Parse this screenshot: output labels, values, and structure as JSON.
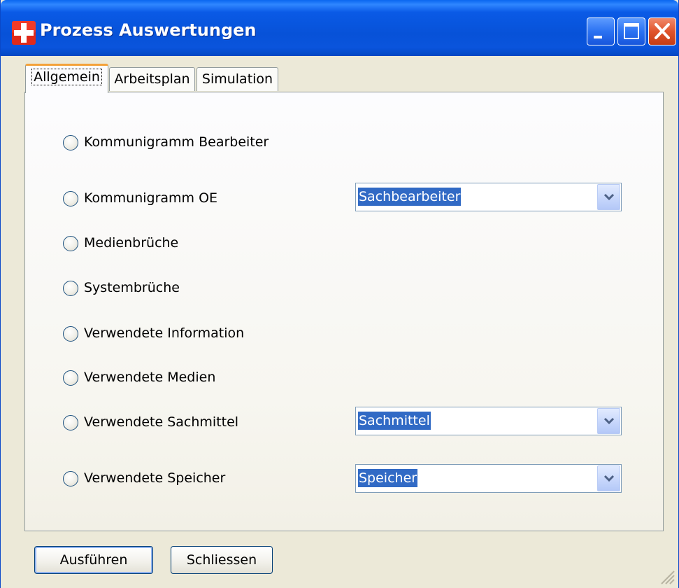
{
  "window": {
    "title": "Prozess Auswertungen",
    "titlebar_color": "#0a54dc"
  },
  "titlebar_buttons": {
    "minimize": "minimize-icon",
    "maximize": "maximize-icon",
    "close": "close-icon"
  },
  "tabs": [
    {
      "label": "Allgemein",
      "active": true
    },
    {
      "label": "Arbeitsplan",
      "active": false
    },
    {
      "label": "Simulation",
      "active": false
    }
  ],
  "options": [
    {
      "label": "Kommunigramm Bearbeiter"
    },
    {
      "label": "Kommunigramm OE"
    },
    {
      "label": "Medienbrüche"
    },
    {
      "label": "Systembrüche"
    },
    {
      "label": "Verwendete Information"
    },
    {
      "label": "Verwendete Medien"
    },
    {
      "label": "Verwendete Sachmittel"
    },
    {
      "label": "Verwendete Speicher"
    }
  ],
  "selects": {
    "oe": {
      "value": "Sachbearbeiter"
    },
    "sachmittel": {
      "value": "Sachmittel"
    },
    "speicher": {
      "value": "Speicher"
    }
  },
  "buttons": {
    "run": "Ausführen",
    "close": "Schliessen"
  },
  "colors": {
    "selection": "#316ac5",
    "tab_highlight": "#f4a23a",
    "window_bg": "#ece9d8"
  }
}
